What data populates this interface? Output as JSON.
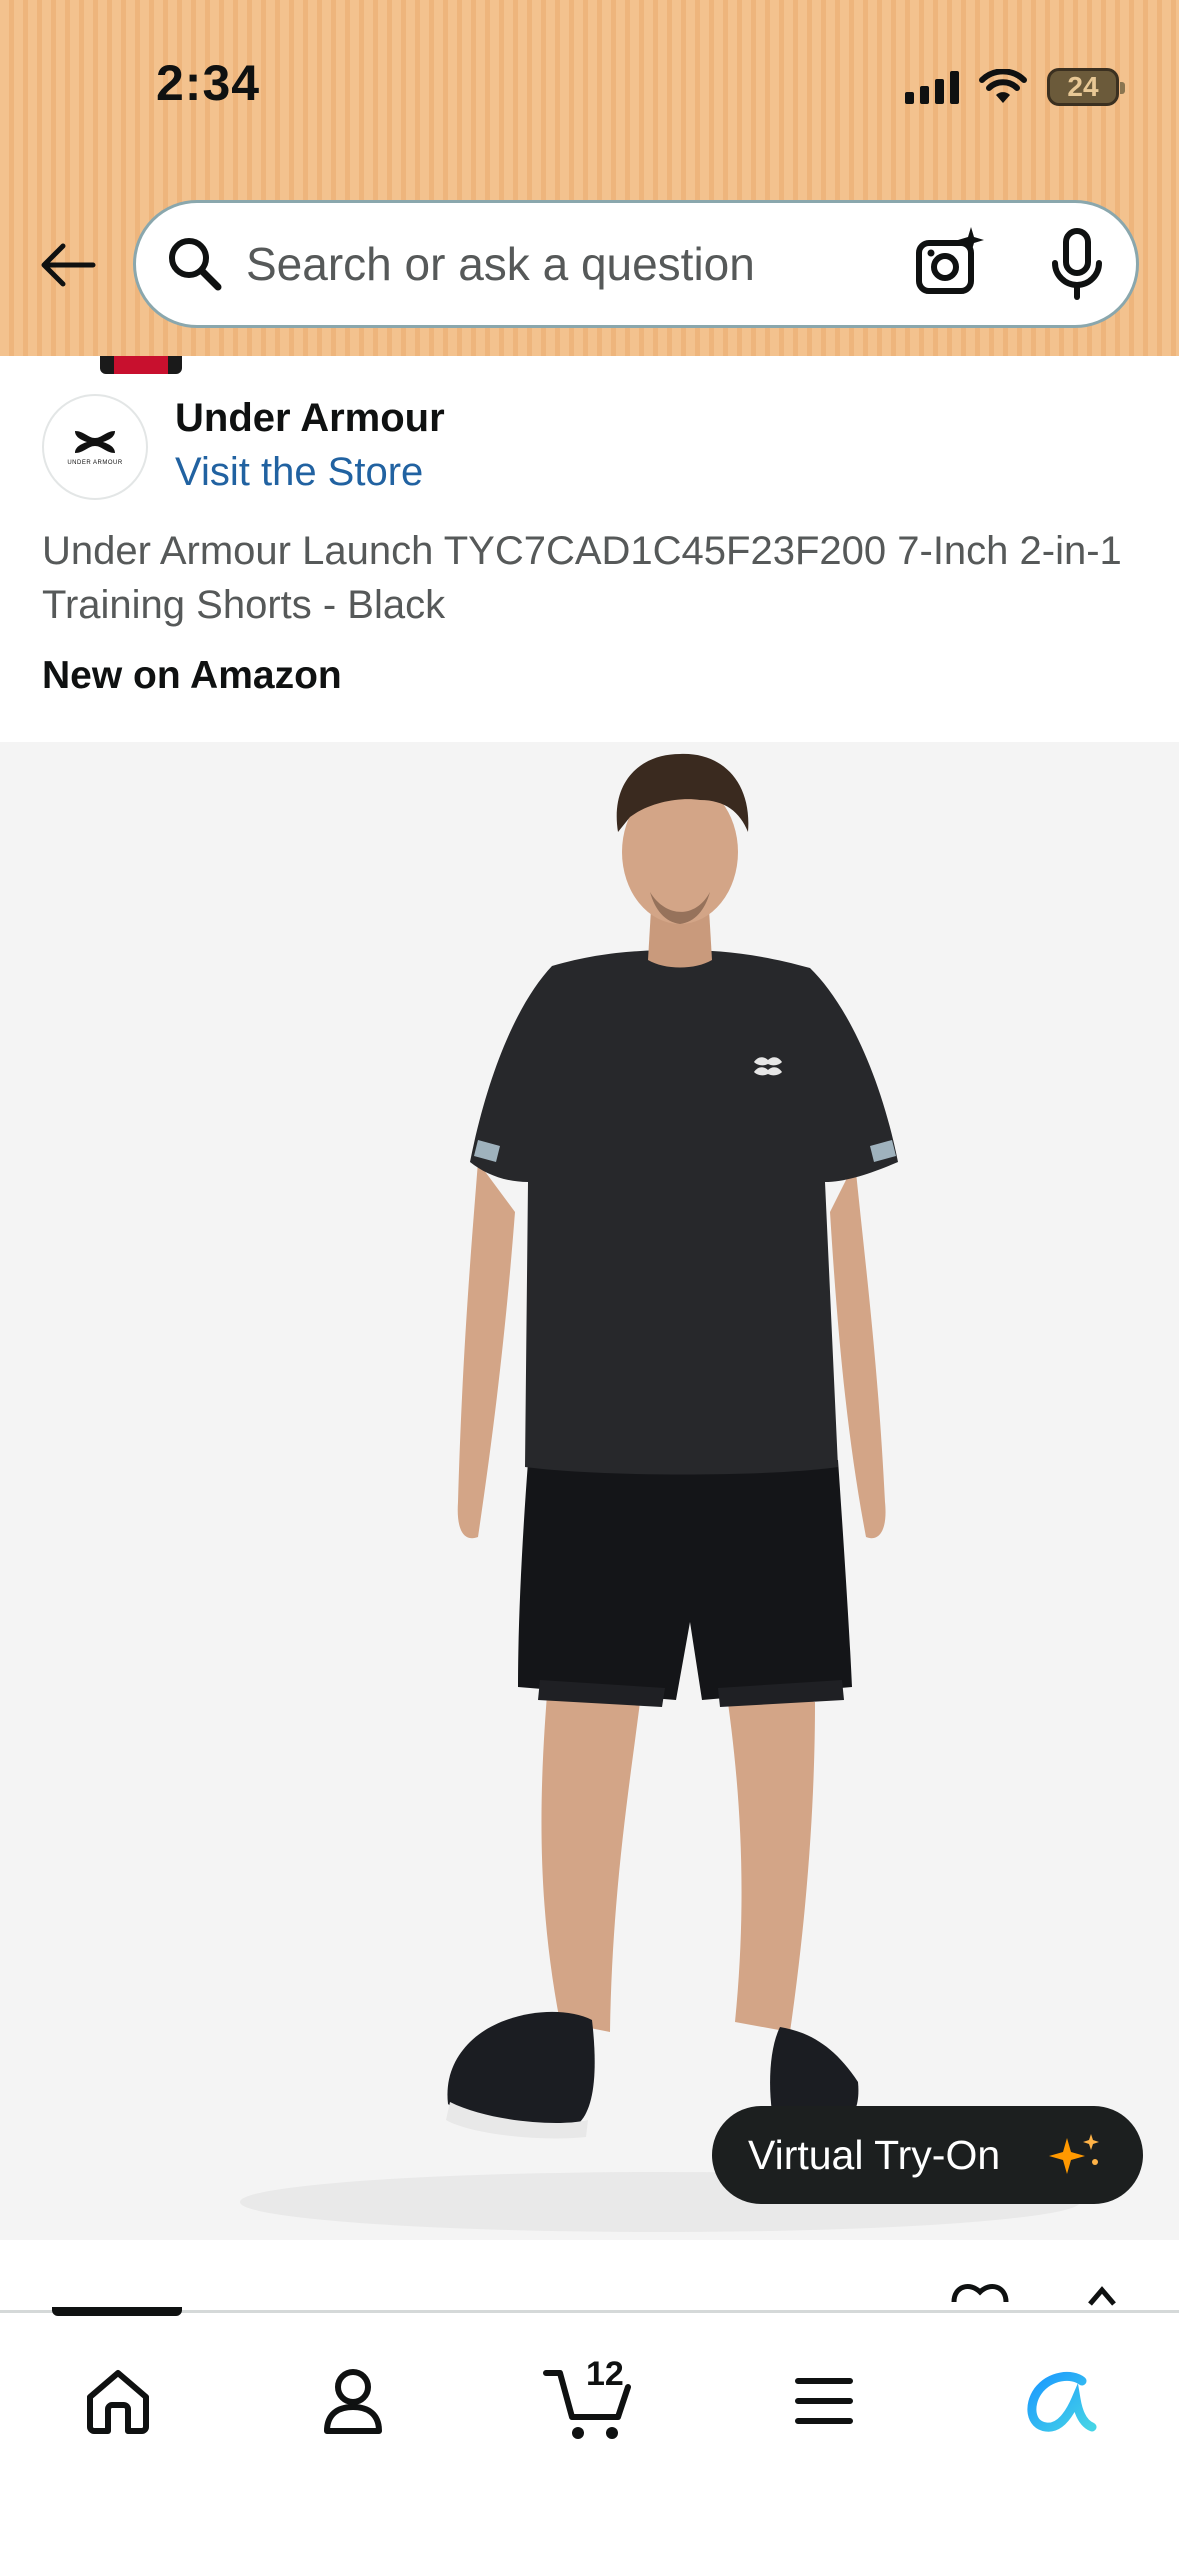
{
  "status_bar": {
    "time": "2:34",
    "battery": "24"
  },
  "search": {
    "placeholder": "Search or ask a question"
  },
  "brand": {
    "logo_text": "UNDER ARMOUR",
    "name": "Under Armour",
    "store_link": "Visit the Store"
  },
  "product": {
    "title": "Under Armour Launch TYC7CAD1C45F23F200 7-Inch 2-in-1 Training Shorts - Black",
    "badge": "New on Amazon"
  },
  "virtual_try_on": {
    "label": "Virtual Try-On"
  },
  "bottom_nav": {
    "cart_count": "12",
    "items": [
      "home-icon",
      "account-icon",
      "cart-icon",
      "menu-icon",
      "rufus-icon"
    ]
  },
  "colors": {
    "header_bg": "#f3c28e",
    "link": "#2162a1",
    "accent_orange": "#ff9900",
    "rufus_blue": "#1a98ff"
  }
}
